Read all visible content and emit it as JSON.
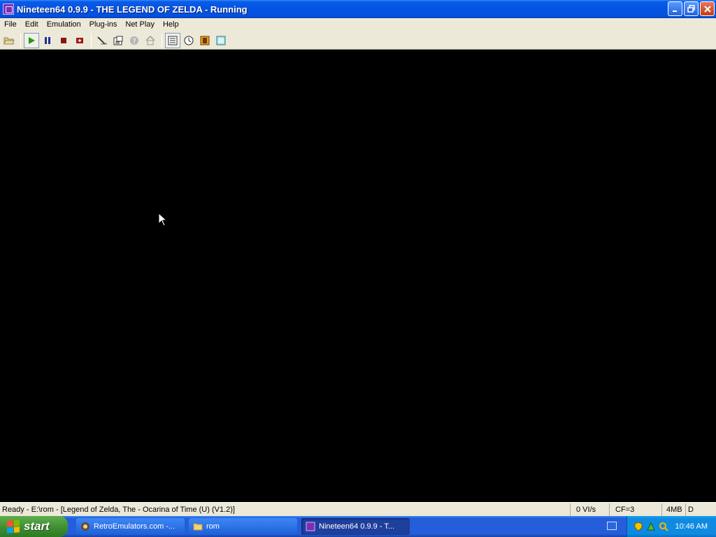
{
  "window": {
    "title": "Nineteen64 0.9.9 - THE LEGEND OF ZELDA - Running",
    "icon": "nineteen64-app-icon"
  },
  "menu": {
    "items": [
      "File",
      "Edit",
      "Emulation",
      "Plug-ins",
      "Net Play",
      "Help"
    ]
  },
  "toolbar": {
    "buttons": [
      {
        "name": "open-rom",
        "icon": "folder-open-icon"
      },
      {
        "name": "play",
        "icon": "play-icon"
      },
      {
        "name": "pause",
        "icon": "pause-icon"
      },
      {
        "name": "stop",
        "icon": "stop-icon"
      },
      {
        "name": "reset",
        "icon": "reset-icon"
      },
      {
        "name": "settings-tool",
        "icon": "wrench-icon"
      },
      {
        "name": "rom-info",
        "icon": "document-icon"
      },
      {
        "name": "help",
        "icon": "question-icon"
      },
      {
        "name": "home",
        "icon": "home-icon"
      },
      {
        "name": "fullscreen",
        "icon": "grid-icon"
      },
      {
        "name": "clock",
        "icon": "clock-icon"
      },
      {
        "name": "film",
        "icon": "film-icon"
      },
      {
        "name": "screenshot",
        "icon": "monitor-icon"
      }
    ]
  },
  "status": {
    "main": "Ready - E:\\rom - [Legend of Zelda, The - Ocarina of Time (U) (V1.2)]",
    "vi": "0 VI/s",
    "cf": "CF=3",
    "mem": "4MB",
    "mode": "D"
  },
  "taskbar": {
    "start_label": "start",
    "tasks": [
      {
        "label": "RetroEmulators.com -...",
        "active": false
      },
      {
        "label": "rom",
        "active": false
      },
      {
        "label": "Nineteen64 0.9.9 - T...",
        "active": true
      }
    ],
    "clock": "10:46 AM"
  },
  "colors": {
    "titlebar": "#0554e3",
    "menubar": "#ece9d8",
    "render_background": "#000000",
    "taskbar": "#245edb",
    "start_button": "#3c8c2f",
    "tray": "#0e8be0"
  }
}
